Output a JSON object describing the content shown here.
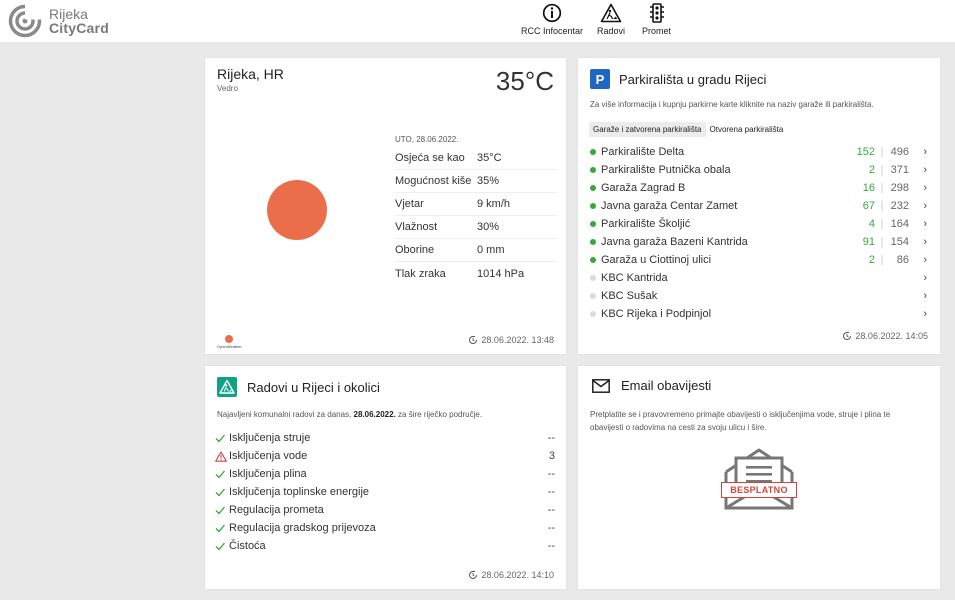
{
  "brand": {
    "line1": "Rijeka",
    "line2": "CityCard"
  },
  "nav": {
    "infocentar": "RCC Infocentar",
    "radovi": "Radovi",
    "promet": "Promet"
  },
  "weather": {
    "city": "Rijeka, HR",
    "description": "Vedro",
    "temperature": "35°C",
    "date": "UTO, 28.06.2022.",
    "rows": [
      {
        "label": "Osjeća se kao",
        "value": "35°C"
      },
      {
        "label": "Mogućnost kiše",
        "value": "35%"
      },
      {
        "label": "Vjetar",
        "value": "9 km/h"
      },
      {
        "label": "Vlažnost",
        "value": "30%"
      },
      {
        "label": "Oborine",
        "value": "0 mm"
      },
      {
        "label": "Tlak zraka",
        "value": "1014 hPa"
      }
    ],
    "provider": "OpenWeather",
    "updated": "28.06.2022. 13:48",
    "sun_color": "#eb6e4b"
  },
  "parking": {
    "badge": "P",
    "title": "Parkirališta u gradu Rijeci",
    "info": "Za više informacija i kupnju parkirne karte kliknite na naziv garaže ili parkirališta.",
    "tabs": [
      "Garaže i zatvorena parkirališta",
      "Otvorena parkirališta"
    ],
    "active_tab": 0,
    "items": [
      {
        "name": "Parkiralište Delta",
        "free": "152",
        "total": "496",
        "active": true
      },
      {
        "name": "Parkiralište Putnička obala",
        "free": "2",
        "total": "371",
        "active": true
      },
      {
        "name": "Garaža Zagrad B",
        "free": "16",
        "total": "298",
        "active": true
      },
      {
        "name": "Javna garaža Centar Zamet",
        "free": "67",
        "total": "232",
        "active": true
      },
      {
        "name": "Parkiralište Školjić",
        "free": "4",
        "total": "164",
        "active": true
      },
      {
        "name": "Javna garaža Bazeni Kantrida",
        "free": "91",
        "total": "154",
        "active": true
      },
      {
        "name": "Garaža u Ciottinoj ulici",
        "free": "2",
        "total": "86",
        "active": true
      },
      {
        "name": "KBC Kantrida",
        "free": "",
        "total": "",
        "active": false
      },
      {
        "name": "KBC Sušak",
        "free": "",
        "total": "",
        "active": false
      },
      {
        "name": "KBC Rijeka i Podpinjol",
        "free": "",
        "total": "",
        "active": false
      }
    ],
    "separator": "|",
    "arrow": "›",
    "updated": "28.06.2022. 14:05",
    "color_free": "#36a93a",
    "badge_color": "#1f67c0"
  },
  "works": {
    "title": "Radovi u Rijeci i okolici",
    "info_prefix": "Najavljeni komunalni radovi za danas,",
    "info_date": "28.06.2022.",
    "info_suffix": "za šire riječko područje.",
    "items": [
      {
        "name": "Isključenja struje",
        "value": "--",
        "icon": "check-icon"
      },
      {
        "name": "Isključenja vode",
        "value": "3",
        "icon": "warning-icon"
      },
      {
        "name": "Isključenja plina",
        "value": "--",
        "icon": "check-icon"
      },
      {
        "name": "Isključenja toplinske energije",
        "value": "--",
        "icon": "check-icon"
      },
      {
        "name": "Regulacija prometa",
        "value": "--",
        "icon": "check-icon"
      },
      {
        "name": "Regulacija gradskog prijevoza",
        "value": "--",
        "icon": "check-icon"
      },
      {
        "name": "Čistoća",
        "value": "--",
        "icon": "check-icon"
      }
    ],
    "updated": "28.06.2022. 14:10",
    "icon_color": "#11a187"
  },
  "email": {
    "title": "Email obavijesti",
    "text": "Pretplatite se i pravovremeno primajte obavijesti o isključenjima vode, struje i plina te obavijesti o radovima na cesti za svoju ulicu i šire.",
    "stamp": "BESPLATNO",
    "stamp_color": "#d0453b"
  }
}
